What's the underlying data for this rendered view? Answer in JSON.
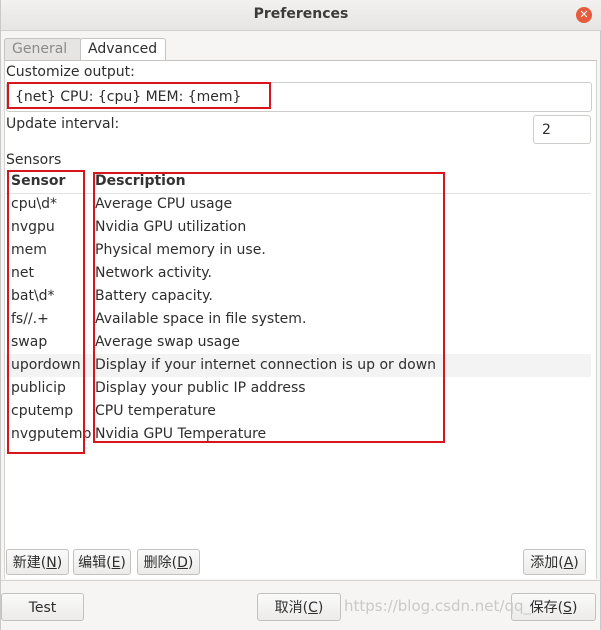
{
  "window": {
    "title": "Preferences"
  },
  "tabs": [
    {
      "label": "General"
    },
    {
      "label": "Advanced"
    }
  ],
  "output": {
    "label": "Customize output:",
    "value": "{net}   CPU: {cpu}   MEM: {mem}"
  },
  "interval": {
    "label": "Update interval:",
    "value": "2"
  },
  "sensors": {
    "label": "Sensors",
    "columns": [
      "Sensor",
      "Description"
    ],
    "rows": [
      {
        "sensor": "cpu\\d*",
        "description": "Average CPU usage"
      },
      {
        "sensor": "nvgpu",
        "description": "Nvidia GPU utilization"
      },
      {
        "sensor": "mem",
        "description": "Physical memory in use."
      },
      {
        "sensor": "net",
        "description": "Network activity."
      },
      {
        "sensor": "bat\\d*",
        "description": "Battery capacity."
      },
      {
        "sensor": "fs//.+",
        "description": "Available space in file system."
      },
      {
        "sensor": "swap",
        "description": "Average swap usage"
      },
      {
        "sensor": "upordown",
        "description": "Display if your internet connection is up or down"
      },
      {
        "sensor": "publicip",
        "description": "Display your public IP address"
      },
      {
        "sensor": "cputemp",
        "description": "CPU temperature"
      },
      {
        "sensor": "nvgputemp",
        "description": "Nvidia GPU Temperature"
      }
    ]
  },
  "actions": {
    "new": {
      "text": "新建(",
      "key": "N",
      "end": ")"
    },
    "edit": {
      "text": "编辑(",
      "key": "E",
      "end": ")"
    },
    "delete": {
      "text": "删除(",
      "key": "D",
      "end": ")"
    },
    "add": {
      "text": "添加(",
      "key": "A",
      "end": ")"
    }
  },
  "footer": {
    "test": "Test",
    "cancel": {
      "text": "取消(",
      "key": "C",
      "end": ")"
    },
    "save": {
      "text": "保存(",
      "key": "S",
      "end": ")"
    }
  },
  "watermark": "https://blog.csdn.net/qq_",
  "colors": {
    "highlight_box": "#d9141b",
    "close_button": "#e55b3c"
  }
}
